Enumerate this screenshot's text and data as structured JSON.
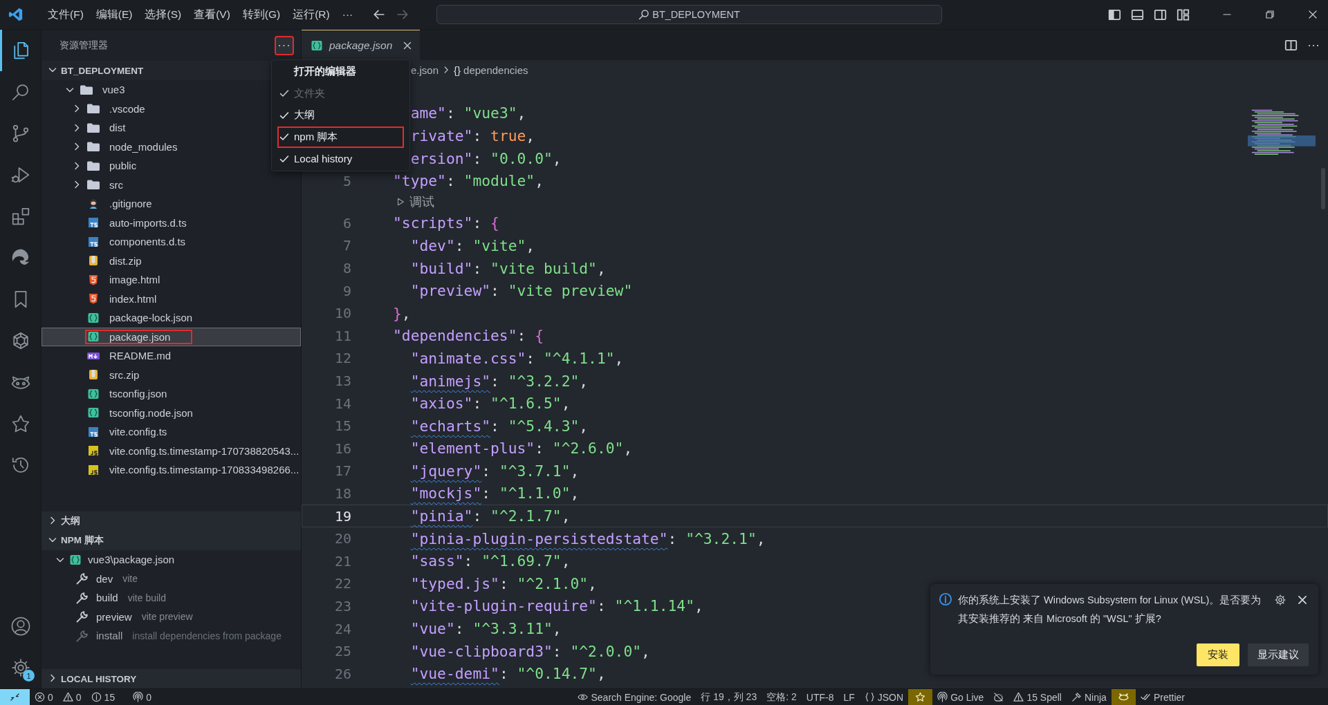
{
  "title_bar": {
    "menus": [
      "文件(F)",
      "编辑(E)",
      "选择(S)",
      "查看(V)",
      "转到(G)",
      "运行(R)"
    ],
    "more": "···",
    "search": "BT_DEPLOYMENT"
  },
  "activity_bar": {
    "items": [
      {
        "kind": "files",
        "selected": true
      },
      {
        "kind": "search",
        "selected": false
      },
      {
        "kind": "source-control",
        "selected": false
      },
      {
        "kind": "run-debug",
        "selected": false
      },
      {
        "kind": "extensions",
        "selected": false
      },
      {
        "kind": "swirl",
        "selected": false
      },
      {
        "kind": "bookmark",
        "selected": false
      },
      {
        "kind": "knot",
        "selected": false
      },
      {
        "kind": "raccoon",
        "selected": false
      },
      {
        "kind": "star",
        "selected": false
      },
      {
        "kind": "history",
        "selected": false
      }
    ],
    "settings_badge": "1"
  },
  "sidebar": {
    "title": "资源管理器",
    "more_button": {
      "label": "···",
      "marked": true
    },
    "root": {
      "label": "BT_DEPLOYMENT",
      "expanded": true
    },
    "tree": [
      {
        "label": "vue3",
        "kind": "folder",
        "expanded": true,
        "selected": false,
        "marked": false,
        "children": [
          {
            "label": ".vscode",
            "kind": "folder",
            "expanded": false,
            "selected": false,
            "marked": false
          },
          {
            "label": "dist",
            "kind": "folder",
            "expanded": false,
            "selected": false,
            "marked": false
          },
          {
            "label": "node_modules",
            "kind": "folder",
            "expanded": false,
            "selected": false,
            "marked": false
          },
          {
            "label": "public",
            "kind": "folder",
            "expanded": false,
            "selected": false,
            "marked": false
          },
          {
            "label": "src",
            "kind": "folder",
            "expanded": false,
            "selected": false,
            "marked": false
          },
          {
            "label": ".gitignore",
            "kind": "git",
            "selected": false,
            "marked": false
          },
          {
            "label": "auto-imports.d.ts",
            "kind": "ts",
            "selected": false,
            "marked": false
          },
          {
            "label": "components.d.ts",
            "kind": "ts",
            "selected": false,
            "marked": false
          },
          {
            "label": "dist.zip",
            "kind": "zip",
            "selected": false,
            "marked": false
          },
          {
            "label": "image.html",
            "kind": "html",
            "selected": false,
            "marked": false
          },
          {
            "label": "index.html",
            "kind": "html",
            "selected": false,
            "marked": false
          },
          {
            "label": "package-lock.json",
            "kind": "json",
            "selected": false,
            "marked": false
          },
          {
            "label": "package.json",
            "kind": "json",
            "selected": true,
            "marked": true
          },
          {
            "label": "README.md",
            "kind": "md",
            "selected": false,
            "marked": false
          },
          {
            "label": "src.zip",
            "kind": "zip",
            "selected": false,
            "marked": false
          },
          {
            "label": "tsconfig.json",
            "kind": "json",
            "selected": false,
            "marked": false
          },
          {
            "label": "tsconfig.node.json",
            "kind": "json",
            "selected": false,
            "marked": false
          },
          {
            "label": "vite.config.ts",
            "kind": "ts",
            "selected": false,
            "marked": false
          },
          {
            "label": "vite.config.ts.timestamp-170738820543...",
            "kind": "js",
            "selected": false,
            "marked": false
          },
          {
            "label": "vite.config.ts.timestamp-170833498266...",
            "kind": "js",
            "selected": false,
            "marked": false
          }
        ]
      }
    ],
    "outline": {
      "title": "大纲",
      "expanded": false
    },
    "npm_scripts": {
      "title": "NPM 脚本",
      "expanded": true,
      "package": {
        "label": "vue3\\package.json",
        "expanded": true
      },
      "scripts": [
        {
          "name": "dev",
          "command": "vite",
          "disabled": false
        },
        {
          "name": "build",
          "command": "vite build",
          "disabled": false
        },
        {
          "name": "preview",
          "command": "vite preview",
          "disabled": false
        },
        {
          "name": "install",
          "command": "install dependencies from package",
          "disabled": true
        }
      ]
    },
    "local_history": {
      "title": "LOCAL HISTORY",
      "expanded": false
    }
  },
  "menu": {
    "items": [
      {
        "label": "打开的编辑器",
        "checked": false,
        "disabled": false,
        "marked": false
      },
      {
        "label": "文件夹",
        "checked": true,
        "disabled": true,
        "marked": false
      },
      {
        "label": "大纲",
        "checked": true,
        "disabled": false,
        "marked": false
      },
      {
        "label": "npm 脚本",
        "checked": true,
        "disabled": false,
        "marked": true
      },
      {
        "label": "Local history",
        "checked": true,
        "disabled": false,
        "marked": false
      }
    ]
  },
  "editor": {
    "tab": {
      "label": "package.json",
      "preview": true
    },
    "breadcrumb": [
      {
        "label": "e.json"
      },
      {
        "symbol": "{}",
        "label": "dependencies"
      }
    ],
    "lines": [
      {
        "kind": "cut",
        "text": "ame\": \"vue3\",",
        "current": false,
        "spell": false
      },
      {
        "kind": "cut",
        "text": "rivate\": true,",
        "current": false,
        "spell": false
      },
      {
        "kind": "cut",
        "text": "ersion\": \"0.0.0\",",
        "current": false,
        "spell": false
      },
      {
        "kind": "code",
        "number": "5",
        "text": "\"type\": \"module\",",
        "current": false,
        "spell": false
      },
      {
        "kind": "codelens",
        "text": "调试"
      },
      {
        "kind": "code",
        "number": "6",
        "text": "\"scripts\": {",
        "current": false,
        "spell": false
      },
      {
        "kind": "code",
        "number": "7",
        "text": "  \"dev\": \"vite\",",
        "current": false,
        "spell": false
      },
      {
        "kind": "code",
        "number": "8",
        "text": "  \"build\": \"vite build\",",
        "current": false,
        "spell": false
      },
      {
        "kind": "code",
        "number": "9",
        "text": "  \"preview\": \"vite preview\"",
        "current": false,
        "spell": false
      },
      {
        "kind": "code",
        "number": "10",
        "text": "},",
        "current": false,
        "spell": false
      },
      {
        "kind": "code",
        "number": "11",
        "text": "\"dependencies\": {",
        "current": false,
        "spell": false
      },
      {
        "kind": "code",
        "number": "12",
        "text": "  \"animate.css\": \"^4.1.1\",",
        "current": false,
        "spell": false
      },
      {
        "kind": "code",
        "number": "13",
        "text": "  \"animejs\": \"^3.2.2\",",
        "current": false,
        "spell": true
      },
      {
        "kind": "code",
        "number": "14",
        "text": "  \"axios\": \"^1.6.5\",",
        "current": false,
        "spell": false
      },
      {
        "kind": "code",
        "number": "15",
        "text": "  \"echarts\": \"^5.4.3\",",
        "current": false,
        "spell": true
      },
      {
        "kind": "code",
        "number": "16",
        "text": "  \"element-plus\": \"^2.6.0\",",
        "current": false,
        "spell": false
      },
      {
        "kind": "code",
        "number": "17",
        "text": "  \"jquery\": \"^3.7.1\",",
        "current": false,
        "spell": true
      },
      {
        "kind": "code",
        "number": "18",
        "text": "  \"mockjs\": \"^1.1.0\",",
        "current": false,
        "spell": true
      },
      {
        "kind": "code",
        "number": "19",
        "text": "  \"pinia\": \"^2.1.7\",",
        "current": true,
        "spell": true
      },
      {
        "kind": "code",
        "number": "20",
        "text": "  \"pinia-plugin-persistedstate\": \"^3.2.1\",",
        "current": false,
        "spell": true
      },
      {
        "kind": "code",
        "number": "21",
        "text": "  \"sass\": \"^1.69.7\",",
        "current": false,
        "spell": false
      },
      {
        "kind": "code",
        "number": "22",
        "text": "  \"typed.js\": \"^2.1.0\",",
        "current": false,
        "spell": false
      },
      {
        "kind": "code",
        "number": "23",
        "text": "  \"vite-plugin-require\": \"^1.1.14\",",
        "current": false,
        "spell": false
      },
      {
        "kind": "code",
        "number": "24",
        "text": "  \"vue\": \"^3.3.11\",",
        "current": false,
        "spell": false
      },
      {
        "kind": "code",
        "number": "25",
        "text": "  \"vue-clipboard3\": \"^2.0.0\",",
        "current": false,
        "spell": false
      },
      {
        "kind": "code",
        "number": "26",
        "text": "  \"vue-demi\": \"^0.14.7\",",
        "current": false,
        "spell": true
      }
    ]
  },
  "notification": {
    "message": "你的系统上安装了 Windows Subsystem for Linux (WSL)。是否要为其安装推荐的 来自 Microsoft 的 \"WSL\" 扩展?",
    "buttons": [
      {
        "label": "安装",
        "primary": true
      },
      {
        "label": "显示建议",
        "primary": false
      }
    ]
  },
  "status_bar": {
    "left": [
      {
        "kind": "remote"
      },
      {
        "kind": "errors",
        "text": "0"
      },
      {
        "kind": "warnings",
        "text": "0"
      },
      {
        "kind": "info",
        "text": "15"
      },
      {
        "kind": "ports",
        "text": "0"
      }
    ],
    "right": [
      {
        "kind": "eye",
        "text": "Search Engine: Google",
        "highlighted": false
      },
      {
        "kind": "plain",
        "text": "行 19，列 23",
        "highlighted": false
      },
      {
        "kind": "plain",
        "text": "空格: 2",
        "highlighted": false
      },
      {
        "kind": "plain",
        "text": "UTF-8",
        "highlighted": false
      },
      {
        "kind": "plain",
        "text": "LF",
        "highlighted": false
      },
      {
        "kind": "braces",
        "text": "JSON",
        "highlighted": false
      },
      {
        "kind": "star",
        "highlighted": true
      },
      {
        "kind": "broadcast",
        "text": "Go Live",
        "highlighted": false
      },
      {
        "kind": "crossed",
        "highlighted": false
      },
      {
        "kind": "warning",
        "text": "15 Spell",
        "highlighted": false
      },
      {
        "kind": "ninja",
        "text": "Ninja",
        "highlighted": false
      },
      {
        "kind": "raccoon",
        "highlighted": true
      },
      {
        "kind": "checks",
        "text": "Prettier",
        "highlighted": false
      }
    ]
  }
}
